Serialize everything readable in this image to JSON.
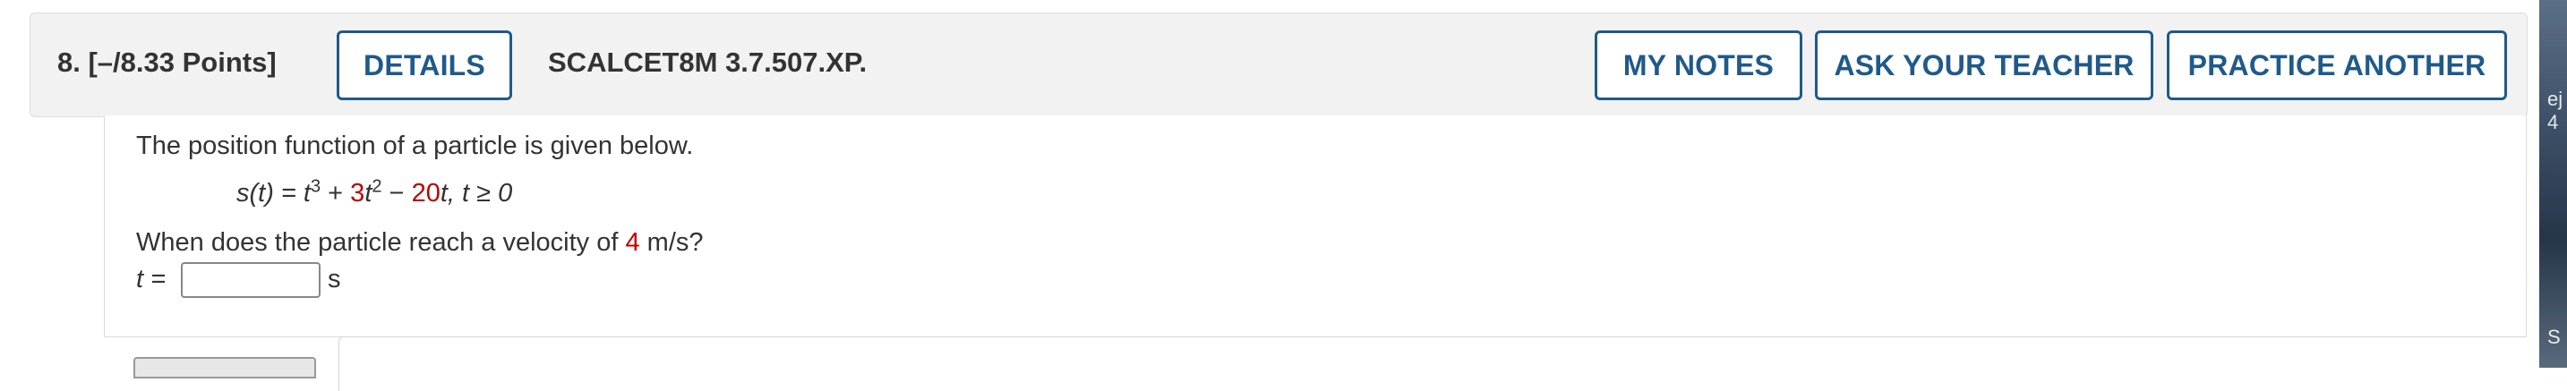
{
  "question": {
    "number_points": "8.  [–/8.33 Points]",
    "id": "SCALCET8M 3.7.507.XP."
  },
  "buttons": {
    "details": "DETAILS",
    "my_notes": "MY NOTES",
    "ask_teacher": "ASK YOUR TEACHER",
    "practice_another": "PRACTICE ANOTHER"
  },
  "body": {
    "intro": "The position function of a particle is given below.",
    "equation": {
      "s_lhs": "s(t) = ",
      "t1": "t",
      "exp1": "3",
      "plus": " + ",
      "coef2": "3",
      "t2": "t",
      "exp2": "2",
      "minus": " − ",
      "coef3": "20",
      "t3": "t",
      "tail": ", t ≥ 0"
    },
    "prompt_before": "When does the particle reach a velocity of ",
    "prompt_value": "4",
    "prompt_after": " m/s?",
    "answer_label": "t = ",
    "answer_value": "",
    "answer_unit": "s"
  },
  "side_strip": {
    "glyph_top": "ej",
    "glyph_mid": "4",
    "glyph_bottom": "S"
  },
  "colors": {
    "accent": "#1f5a8a",
    "highlight": "#c00000"
  }
}
